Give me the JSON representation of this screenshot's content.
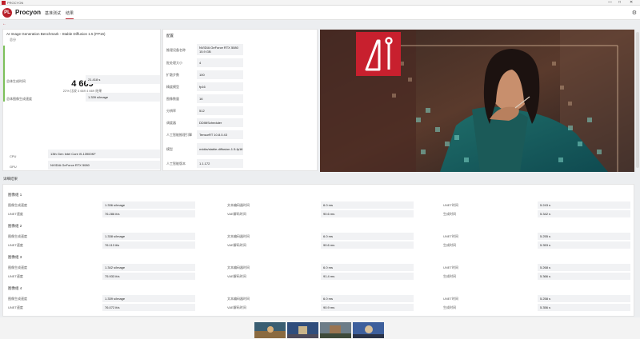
{
  "window": {
    "title": "PROCYON",
    "minimize": "—",
    "maximize": "□",
    "close": "✕"
  },
  "header": {
    "logo_text": "PL",
    "brand": "Procyon",
    "nav": [
      {
        "label": "基准测试",
        "active": false
      },
      {
        "label": "结果",
        "active": true
      }
    ],
    "gear_icon": "gear-icon"
  },
  "back": {
    "icon": "arrow-left-icon",
    "label": "←"
  },
  "score": {
    "title": "AI Image Generation Benchmark - Stable Diffusion 1.5 (FP16)",
    "subtitle": "总分",
    "value": "4 669",
    "percent_text": "22% 比较 4 669 4 669 结果",
    "accent_color": "#7cc05a",
    "metrics": [
      {
        "label": "总体生成时间",
        "value": "21.418 s"
      },
      {
        "label": "总体图像生成速度",
        "value": "1.339 s/image"
      }
    ],
    "hardware": [
      {
        "label": "CPU",
        "value": "13th Gen Intel Core i9-13900KF"
      },
      {
        "label": "GPU",
        "value": "NVIDIA GeForce RTX 5080"
      }
    ]
  },
  "specs": {
    "title": "配置",
    "rows": [
      {
        "label": "推理设备名称",
        "value": "NVIDIA GeForce RTX 5080 15.9 GB"
      },
      {
        "label": "批处理大小",
        "value": "4"
      },
      {
        "label": "扩散步数",
        "value": "100"
      },
      {
        "label": "精度模型",
        "value": "fp16"
      },
      {
        "label": "图像数量",
        "value": "16"
      },
      {
        "label": "分辨率",
        "value": "512"
      },
      {
        "label": "调度器",
        "value": "DDIMScheduler"
      },
      {
        "label": "人工智能推理引擎",
        "value": "TensorRT 10.8.0.43"
      },
      {
        "label": "模型",
        "value": "nvidia/stable-diffusion-1.5-fp16"
      },
      {
        "label": "人工智能版本",
        "value": "1.1.172"
      }
    ]
  },
  "hero_image": {
    "icon": "ai-logo-icon",
    "brand_color": "#c8202e"
  },
  "details": {
    "heading": "详细结果",
    "passes": [
      {
        "title": "图像组 1",
        "rows": [
          [
            {
              "label": "图像生成速度",
              "value": "1.336 s/image"
            },
            {
              "label": "文本编码器时间",
              "value": "6.0 ms"
            },
            {
              "label": "UNET时间",
              "value": "5.243 s"
            }
          ],
          [
            {
              "label": "UNET速度",
              "value": "76.286 it/s"
            },
            {
              "label": "VAE解码时间",
              "value": "90.6 ms"
            },
            {
              "label": "生成时间",
              "value": "5.342 s"
            }
          ]
        ]
      },
      {
        "title": "图像组 2",
        "rows": [
          [
            {
              "label": "图像生成速度",
              "value": "1.338 s/image"
            },
            {
              "label": "文本编码器时间",
              "value": "6.0 ms"
            },
            {
              "label": "UNET时间",
              "value": "5.255 s"
            }
          ],
          [
            {
              "label": "UNET速度",
              "value": "76.113 it/s"
            },
            {
              "label": "VAE解码时间",
              "value": "90.6 ms"
            },
            {
              "label": "生成时间",
              "value": "5.353 s"
            }
          ]
        ]
      },
      {
        "title": "图像组 3",
        "rows": [
          [
            {
              "label": "图像生成速度",
              "value": "1.342 s/image"
            },
            {
              "label": "文本编码器时间",
              "value": "6.0 ms"
            },
            {
              "label": "UNET时间",
              "value": "5.268 s"
            }
          ],
          [
            {
              "label": "UNET速度",
              "value": "75.933 it/s"
            },
            {
              "label": "VAE解码时间",
              "value": "91.4 ms"
            },
            {
              "label": "生成时间",
              "value": "5.366 s"
            }
          ]
        ]
      },
      {
        "title": "图像组 4",
        "rows": [
          [
            {
              "label": "图像生成速度",
              "value": "1.339 s/image"
            },
            {
              "label": "文本编码器时间",
              "value": "6.0 ms"
            },
            {
              "label": "UNET时间",
              "value": "5.258 s"
            }
          ],
          [
            {
              "label": "UNET速度",
              "value": "76.072 it/s"
            },
            {
              "label": "VAE解码时间",
              "value": "90.9 ms"
            },
            {
              "label": "生成时间",
              "value": "5.356 s"
            }
          ]
        ]
      }
    ]
  },
  "thumbnails": [
    {
      "name": "thumbnail-1"
    },
    {
      "name": "thumbnail-2"
    },
    {
      "name": "thumbnail-3"
    },
    {
      "name": "thumbnail-4"
    }
  ]
}
